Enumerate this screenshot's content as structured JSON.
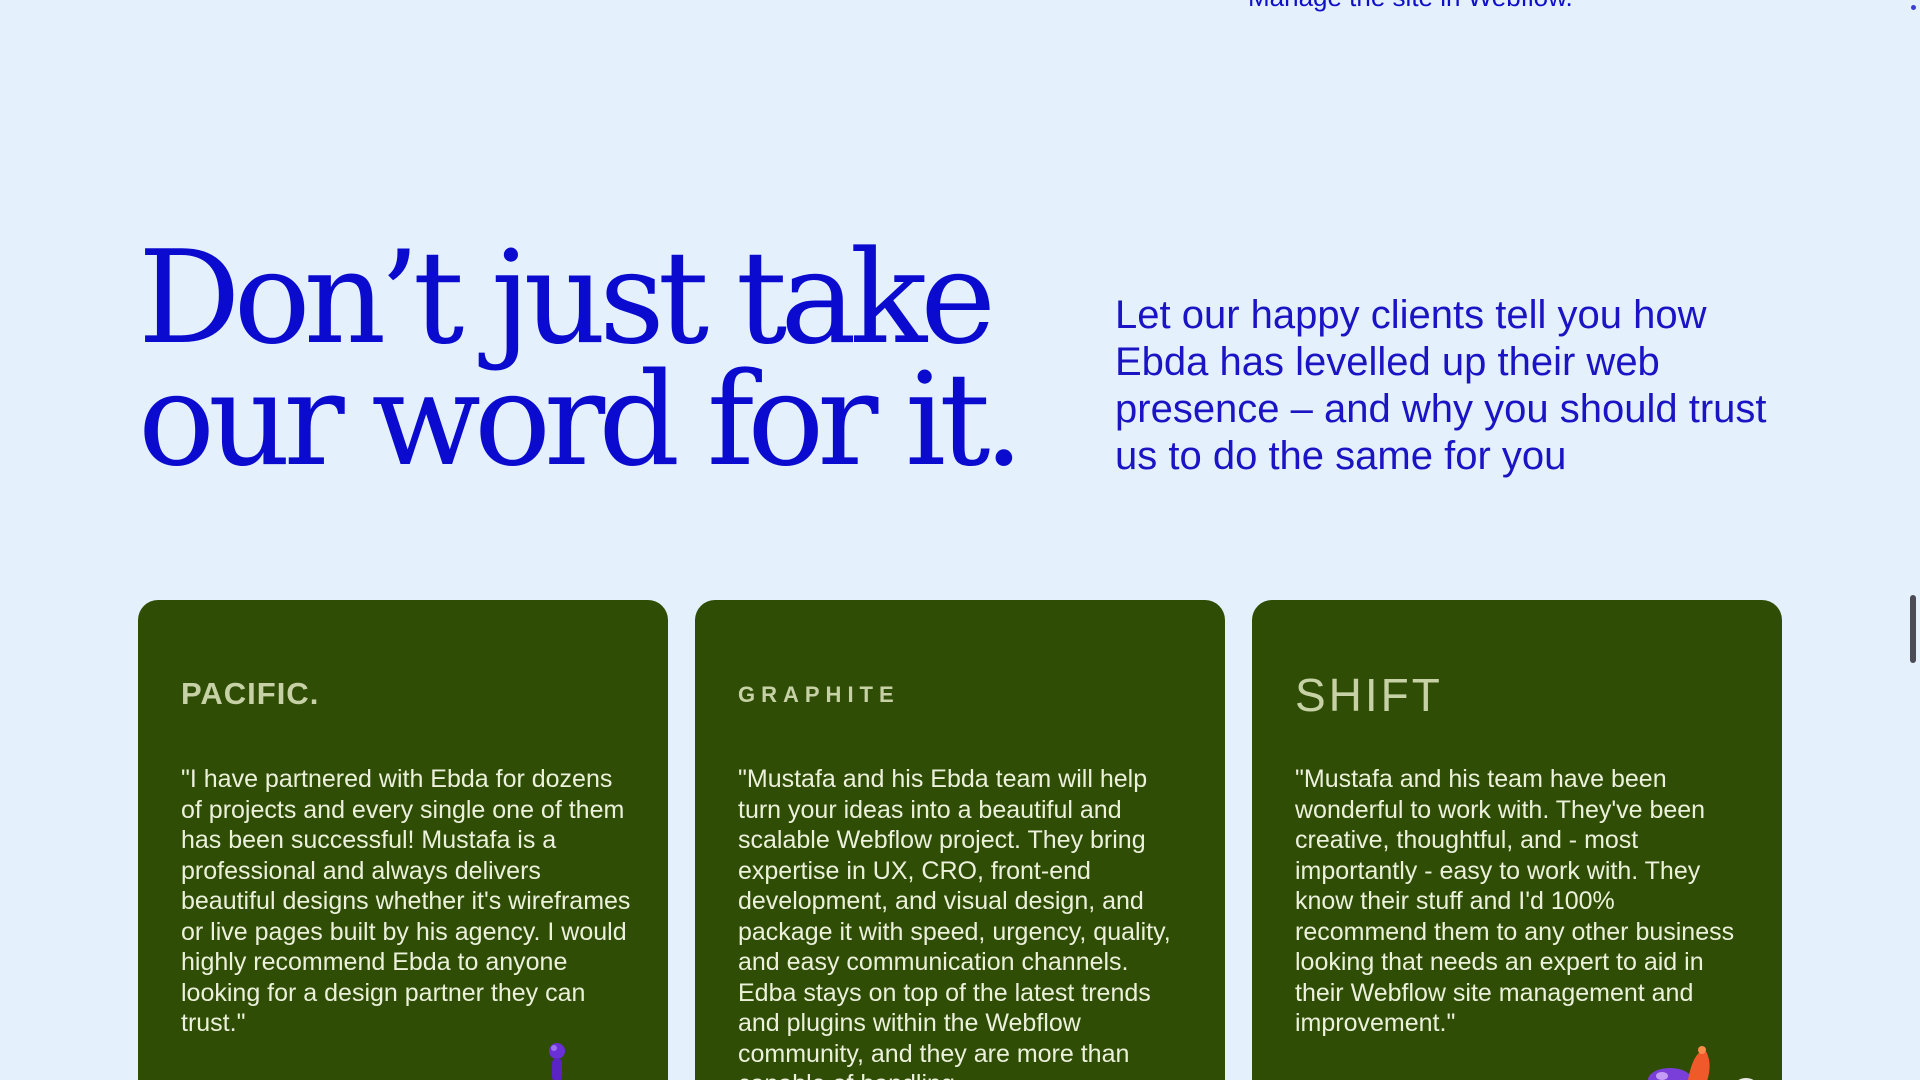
{
  "top_text": "Manage the site in Webflow.",
  "heading": {
    "line1": "Don’t just take",
    "line2": "our word for it."
  },
  "intro": "Let our happy clients tell you how Ebda has levelled up their web presence – and why you should trust us to do the same for you",
  "testimonials": [
    {
      "logo": "PACIFIC.",
      "quote": "\"I have partnered with Ebda for dozens of projects and every single one of them has been successful! Mustafa is a professional and always delivers beautiful designs whether it's wireframes or live pages built by his agency. I would highly recommend Ebda to anyone looking for a design partner they can trust.\""
    },
    {
      "logo": "GRAPHITE",
      "quote": "\"Mustafa and his Ebda team will help turn your ideas into a beautiful and scalable Webflow project. They bring expertise in UX, CRO, front-end development, and visual design, and package it with speed, urgency, quality, and easy communication channels. Edba stays on top of the latest trends and plugins within the Webflow community, and they are more than capable of handling"
    },
    {
      "logo": "SHIFT",
      "quote": "\"Mustafa and his team have been wonderful to work with. They've been creative, thoughtful, and - most importantly - easy to work with. They know their stuff and I'd 100% recommend them to any other business looking that needs an expert to aid in their Webflow site management and improvement.\""
    }
  ],
  "colors": {
    "background": "#e4f1fd",
    "heading": "#0b0bd0",
    "card": "#2f4d05",
    "card_text": "#ecf1dc",
    "logo": "#c7d1a6"
  },
  "icons": {
    "pacific_decoration": "purple-figure-icon",
    "shift_decoration": "orange-figure-icon"
  }
}
